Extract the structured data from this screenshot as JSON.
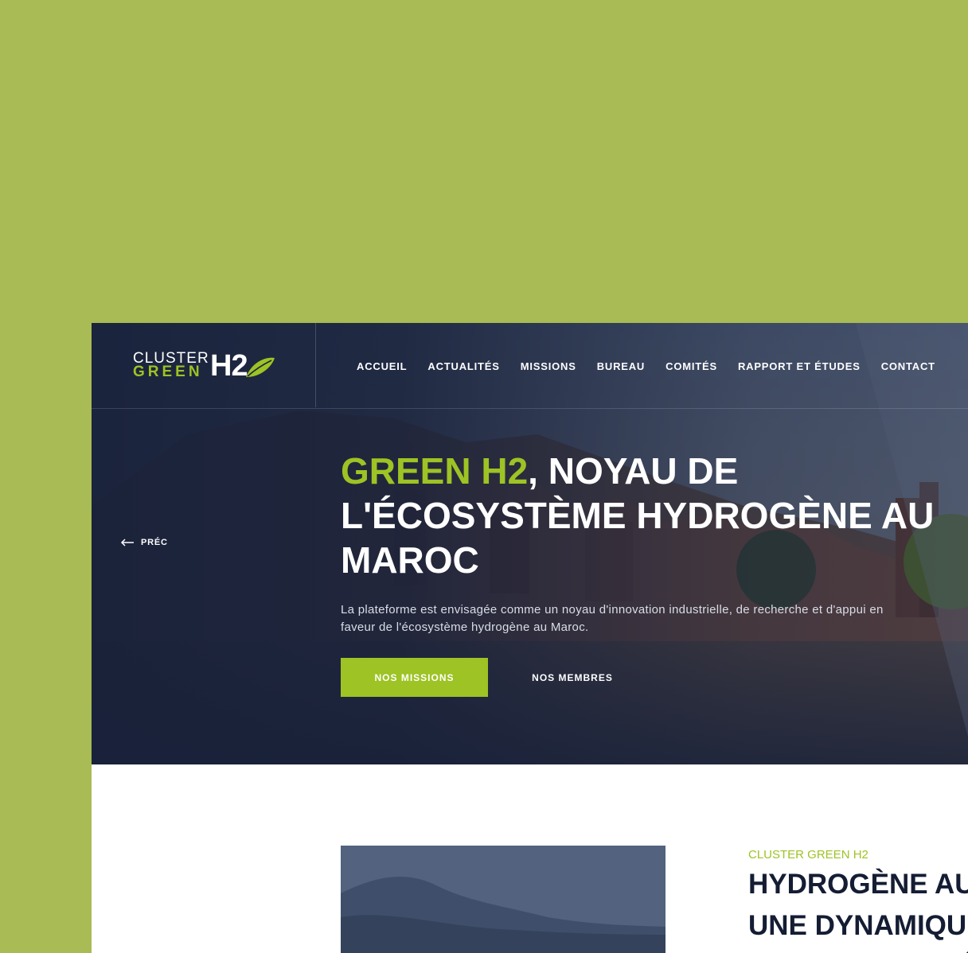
{
  "colors": {
    "page_background": "#a8bb54",
    "navy": "#1a2541",
    "accent_green": "#9dc324",
    "white": "#ffffff"
  },
  "logo": {
    "line1": "CLUSTER",
    "line2": "GREEN",
    "mark": "H2",
    "leaf_icon": "leaf-icon"
  },
  "nav": {
    "items": [
      {
        "label": "ACCUEIL",
        "active": true
      },
      {
        "label": "ACTUALITÉS"
      },
      {
        "label": "MISSIONS"
      },
      {
        "label": "BUREAU"
      },
      {
        "label": "COMITÉS"
      },
      {
        "label": "RAPPORT ET ÉTUDES"
      },
      {
        "label": "CONTACT"
      }
    ]
  },
  "hero": {
    "prev_label": "PRÉC",
    "prev_icon": "arrow-left-icon",
    "title_accent": "GREEN H2",
    "title_rest": ", NOYAU DE L'ÉCOSYSTÈME HYDROGÈNE AU MAROC",
    "description": "La plateforme est envisagée comme un noyau d'innovation industrielle, de recherche et d'appui en faveur de l'écosystème hydrogène au Maroc.",
    "primary_button": "NOS MISSIONS",
    "secondary_button": "NOS MEMBRES"
  },
  "about": {
    "eyebrow": "CLUSTER GREEN H2",
    "title": "HYDROGÈNE AU MAROC : UNE DYNAMIQUE D'OPPORTUNITÉS"
  }
}
